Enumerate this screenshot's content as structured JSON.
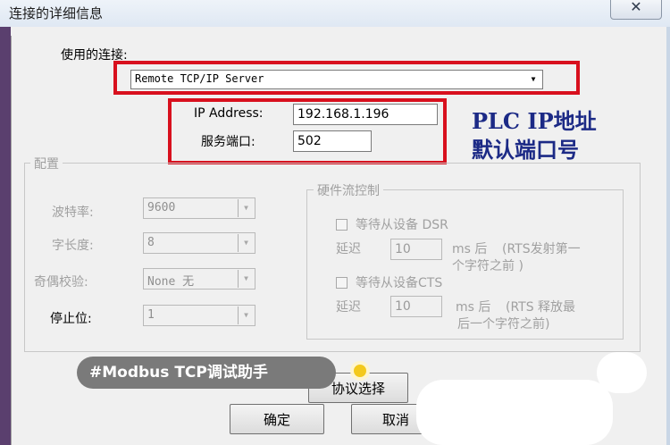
{
  "window": {
    "title": "连接的详细信息",
    "close_glyph": "✕"
  },
  "connection": {
    "label": "使用的连接:",
    "value": "Remote TCP/IP Server"
  },
  "ip": {
    "label": "IP Address:",
    "value": "192.168.1.196"
  },
  "port": {
    "label": "服务端口:",
    "value": "502"
  },
  "annotation": {
    "line1": "PLC  IP地址",
    "line2": "默认端口号"
  },
  "config": {
    "legend": "配置",
    "baud": {
      "label": "波特率:",
      "value": "9600"
    },
    "word_length": {
      "label": "字长度:",
      "value": "8"
    },
    "parity": {
      "label": "奇偶校验:",
      "value": "None 无"
    },
    "stop_bits": {
      "label": "停止位:",
      "value": "1"
    }
  },
  "flow": {
    "legend": "硬件流控制",
    "dsr": {
      "label": "等待从设备 DSR",
      "delay_label": "延迟",
      "delay_value": "10",
      "unit": "ms 后",
      "note_line1": "(RTS发射第一",
      "note_line2": "个字符之前 )"
    },
    "cts": {
      "label": "等待从设备CTS",
      "delay_label": "延迟",
      "delay_value": "10",
      "unit": "ms 后",
      "note_line1": "(RTS 释放最",
      "note_line2": "后一个字符之前)"
    }
  },
  "buttons": {
    "protocol": "协议选择",
    "ok": "确定",
    "cancel": "取消"
  },
  "watermark": {
    "tag": "#Modbus TCP调试助手"
  },
  "colors": {
    "highlight_box": "#d8101e",
    "annotation_text": "#1c2a86",
    "dialog_bg": "#f0f0f0"
  },
  "icons": {
    "dropdown": "chevron-down-icon",
    "close": "close-icon"
  }
}
